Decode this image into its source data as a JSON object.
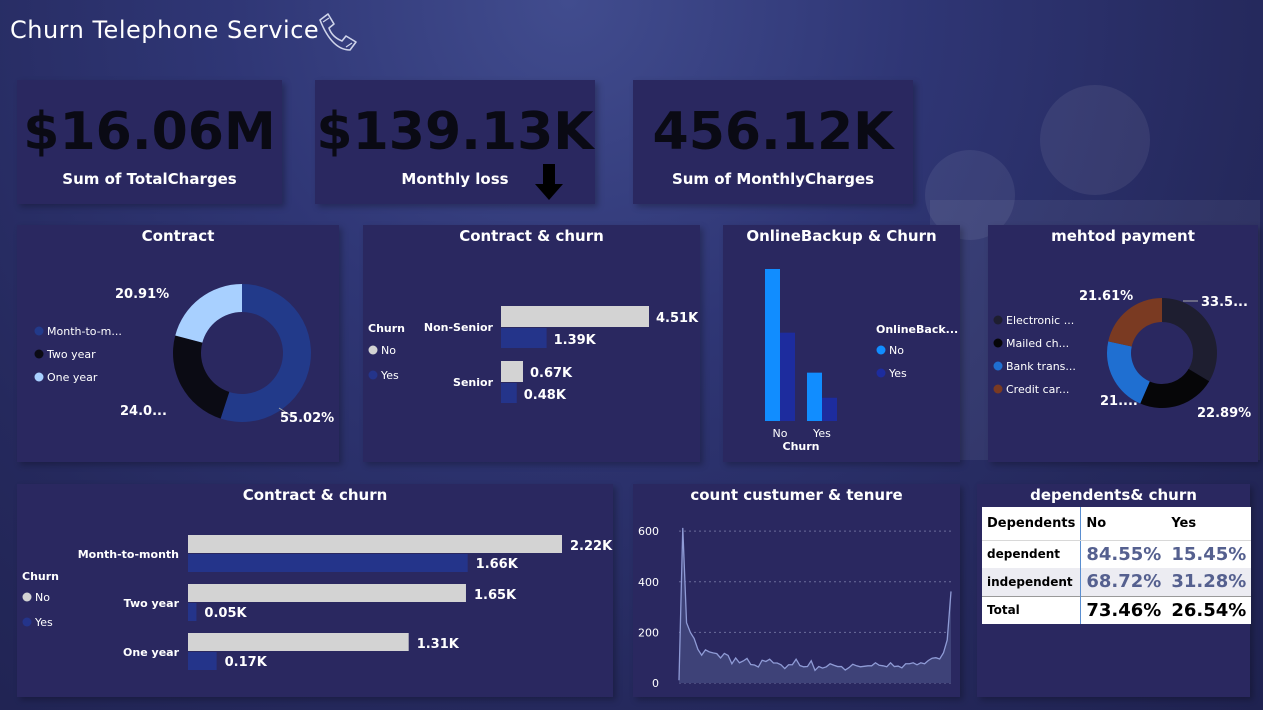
{
  "header": {
    "title": "Churn Telephone Service",
    "icon": "phone-icon"
  },
  "kpis": [
    {
      "value": "$16.06M",
      "label": "Sum of TotalCharges"
    },
    {
      "value": "$139.13K",
      "label": "Monthly loss"
    },
    {
      "value": "456.12K",
      "label": "Sum of MonthlyCharges"
    }
  ],
  "colors": {
    "no": "#d3d3d3",
    "yes": "#24348a",
    "accent": "#118dff"
  },
  "chart_data": [
    {
      "id": "contract_donut",
      "type": "pie",
      "title": "Contract",
      "categories": [
        "Month-to-m...",
        "Two year",
        "One year"
      ],
      "values": [
        55.02,
        24.07,
        20.91
      ],
      "labels": [
        "55.02%",
        "24.0...",
        "20.91%"
      ],
      "colors": [
        "#223a8a",
        "#0b0b14",
        "#a8d0ff"
      ]
    },
    {
      "id": "senior_contract_churn",
      "type": "bar",
      "title": "Contract & churn",
      "legend_title": "Churn",
      "categories": [
        "Non-Senior",
        "Senior"
      ],
      "series": [
        {
          "name": "No",
          "values": [
            4510,
            670
          ],
          "labels": [
            "4.51K",
            "0.67K"
          ]
        },
        {
          "name": "Yes",
          "values": [
            1390,
            480
          ],
          "labels": [
            "1.39K",
            "0.48K"
          ]
        }
      ]
    },
    {
      "id": "onlinebackup_churn",
      "type": "bar",
      "title": "OnlineBackup & Churn",
      "legend_title": "OnlineBack...",
      "xlabel": "Churn",
      "categories": [
        "No",
        "Yes"
      ],
      "series": [
        {
          "name": "No",
          "values": [
            3270,
            1040
          ]
        },
        {
          "name": "Yes",
          "values": [
            1900,
            500
          ]
        }
      ]
    },
    {
      "id": "payment_donut",
      "type": "pie",
      "title": "mehtod payment",
      "categories": [
        "Electronic ...",
        "Mailed ch...",
        "Bank trans...",
        "Credit car..."
      ],
      "values": [
        33.58,
        22.89,
        21.92,
        21.61
      ],
      "labels": [
        "33.5...",
        "22.89%",
        "21....",
        "21.61%"
      ],
      "colors": [
        "#1e1e30",
        "#060608",
        "#1f6fd1",
        "#7a3a22"
      ]
    },
    {
      "id": "contract_type_churn",
      "type": "bar",
      "title": "Contract & churn",
      "legend_title": "Churn",
      "categories": [
        "Month-to-month",
        "Two year",
        "One year"
      ],
      "series": [
        {
          "name": "No",
          "values": [
            2220,
            1650,
            1310
          ],
          "labels": [
            "2.22K",
            "1.65K",
            "1.31K"
          ]
        },
        {
          "name": "Yes",
          "values": [
            1660,
            50,
            170
          ],
          "labels": [
            "1.66K",
            "0.05K",
            "0.17K"
          ]
        }
      ]
    },
    {
      "id": "tenure_count",
      "type": "area",
      "title": "count custumer & tenure",
      "yticks": [
        "600",
        "400",
        "200",
        "0"
      ],
      "ylim": [
        0,
        660
      ],
      "x": [
        0,
        1,
        2,
        3,
        4,
        5,
        6,
        7,
        8,
        9,
        10,
        11,
        12,
        13,
        14,
        15,
        16,
        17,
        18,
        19,
        20,
        21,
        22,
        23,
        24,
        25,
        26,
        27,
        28,
        29,
        30,
        31,
        32,
        33,
        34,
        35,
        36,
        37,
        38,
        39,
        40,
        41,
        42,
        43,
        44,
        45,
        46,
        47,
        48,
        49,
        50,
        51,
        52,
        53,
        54,
        55,
        56,
        57,
        58,
        59,
        60,
        61,
        62,
        63,
        64,
        65,
        66,
        67,
        68,
        69,
        70,
        71,
        72
      ],
      "values": [
        11,
        613,
        238,
        200,
        176,
        133,
        110,
        131,
        123,
        119,
        116,
        99,
        117,
        109,
        76,
        99,
        80,
        87,
        97,
        73,
        71,
        63,
        90,
        85,
        94,
        79,
        79,
        72,
        57,
        72,
        72,
        94,
        69,
        64,
        65,
        88,
        50,
        65,
        59,
        64,
        76,
        70,
        65,
        65,
        51,
        61,
        74,
        68,
        64,
        66,
        68,
        68,
        80,
        70,
        68,
        64,
        80,
        65,
        67,
        60,
        76,
        76,
        80,
        72,
        80,
        76,
        89,
        98,
        100,
        95,
        119,
        170,
        362
      ]
    },
    {
      "id": "dependents_table",
      "type": "table",
      "title": "dependents& churn",
      "columns": [
        "Dependents",
        "No",
        "Yes"
      ],
      "rows": [
        [
          "dependent",
          "84.55%",
          "15.45%"
        ],
        [
          "independent",
          "68.72%",
          "31.28%"
        ],
        [
          "Total",
          "73.46%",
          "26.54%"
        ]
      ]
    }
  ]
}
